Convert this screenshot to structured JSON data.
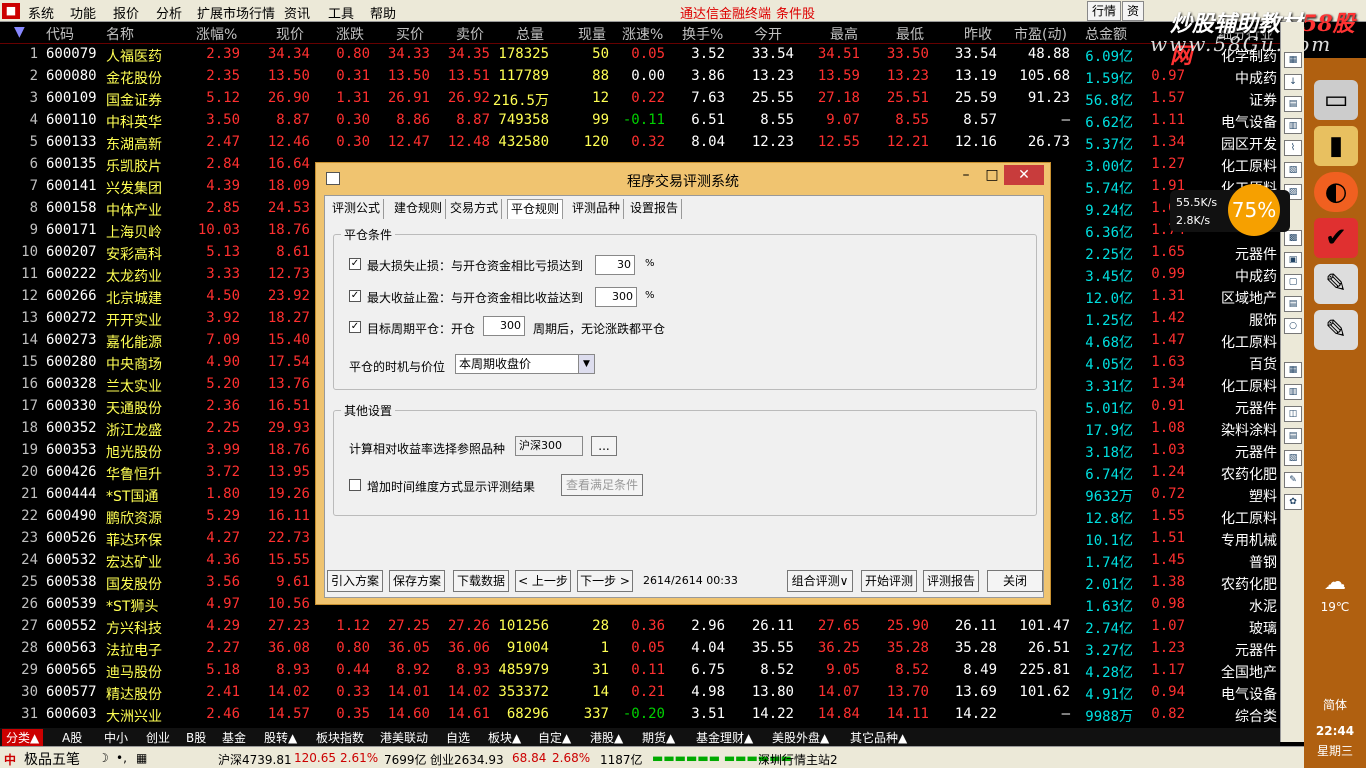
{
  "menu": {
    "items": [
      "系统",
      "功能",
      "报价",
      "分析",
      "扩展市场行情",
      "资讯",
      "工具",
      "帮助"
    ],
    "red": [
      "通达信金融终端",
      "条件股"
    ],
    "right": [
      "行情",
      "资"
    ]
  },
  "watermark": {
    "line1a": "炒股辅助教材",
    "line1b": "58股网",
    "line2": "www.58Gu.com"
  },
  "headers": [
    "代码",
    "名称",
    "涨幅%",
    "现价",
    "涨跌",
    "买价",
    "卖价",
    "总量",
    "现量",
    "涨速%",
    "换手%",
    "今开",
    "最高",
    "最低",
    "昨收",
    "市盈(动)",
    "总金额",
    "",
    "细分行业"
  ],
  "rows": [
    {
      "i": "1",
      "code": "600079",
      "name": "人福医药",
      "chg": "2.39",
      "price": "34.34",
      "diff": "0.80",
      "buy": "34.33",
      "sell": "34.35",
      "vol": "178325",
      "now": "50",
      "spd": "0.05",
      "turn": "3.52",
      "open": "33.54",
      "high": "34.51",
      "low": "33.50",
      "prev": "33.54",
      "pe": "48.88",
      "amt": "6.09亿",
      "x": "",
      "ind": "化学制药"
    },
    {
      "i": "2",
      "code": "600080",
      "name": "金花股份",
      "chg": "2.35",
      "price": "13.50",
      "diff": "0.31",
      "buy": "13.50",
      "sell": "13.51",
      "vol": "117789",
      "now": "88",
      "spd": "0.00",
      "turn": "3.86",
      "open": "13.23",
      "high": "13.59",
      "low": "13.23",
      "prev": "13.19",
      "pe": "105.68",
      "amt": "1.59亿",
      "x": "0.97",
      "ind": "中成药"
    },
    {
      "i": "3",
      "code": "600109",
      "name": "国金证券",
      "chg": "5.12",
      "price": "26.90",
      "diff": "1.31",
      "buy": "26.91",
      "sell": "26.92",
      "vol": "216.5万",
      "now": "12",
      "spd": "0.22",
      "turn": "7.63",
      "open": "25.55",
      "high": "27.18",
      "low": "25.51",
      "prev": "25.59",
      "pe": "91.23",
      "amt": "56.8亿",
      "x": "1.57",
      "ind": "证券"
    },
    {
      "i": "4",
      "code": "600110",
      "name": "中科英华",
      "chg": "3.50",
      "price": "8.87",
      "diff": "0.30",
      "buy": "8.86",
      "sell": "8.87",
      "vol": "749358",
      "now": "99",
      "spd": "-0.11",
      "turn": "6.51",
      "open": "8.55",
      "high": "9.07",
      "low": "8.55",
      "prev": "8.57",
      "pe": "—",
      "amt": "6.62亿",
      "x": "1.11",
      "ind": "电气设备"
    },
    {
      "i": "5",
      "code": "600133",
      "name": "东湖高新",
      "chg": "2.47",
      "price": "12.46",
      "diff": "0.30",
      "buy": "12.47",
      "sell": "12.48",
      "vol": "432580",
      "now": "120",
      "spd": "0.32",
      "turn": "8.04",
      "open": "12.23",
      "high": "12.55",
      "low": "12.21",
      "prev": "12.16",
      "pe": "26.73",
      "amt": "5.37亿",
      "x": "1.34",
      "ind": "园区开发"
    },
    {
      "i": "6",
      "code": "600135",
      "name": "乐凯胶片",
      "chg": "2.84",
      "price": "16.64",
      "diff": "",
      "buy": "",
      "sell": "",
      "vol": "",
      "now": "",
      "spd": "",
      "turn": "",
      "open": "",
      "high": "",
      "low": "",
      "prev": "",
      "pe": "",
      "amt": "3.00亿",
      "x": "1.27",
      "ind": "化工原料"
    },
    {
      "i": "7",
      "code": "600141",
      "name": "兴发集团",
      "chg": "4.39",
      "price": "18.09",
      "diff": "",
      "buy": "",
      "sell": "",
      "vol": "",
      "now": "",
      "spd": "",
      "turn": "",
      "open": "",
      "high": "",
      "low": "",
      "prev": "",
      "pe": "",
      "amt": "5.74亿",
      "x": "1.91",
      "ind": "化工原料"
    },
    {
      "i": "8",
      "code": "600158",
      "name": "中体产业",
      "chg": "2.85",
      "price": "24.53",
      "diff": "",
      "buy": "",
      "sell": "",
      "vol": "",
      "now": "",
      "spd": "",
      "turn": "",
      "open": "",
      "high": "",
      "low": "",
      "prev": "",
      "pe": "",
      "amt": "9.24亿",
      "x": "1.07",
      "ind": ""
    },
    {
      "i": "9",
      "code": "600171",
      "name": "上海贝岭",
      "chg": "10.03",
      "price": "18.76",
      "diff": "",
      "buy": "",
      "sell": "",
      "vol": "",
      "now": "",
      "spd": "",
      "turn": "",
      "open": "",
      "high": "",
      "low": "",
      "prev": "",
      "pe": "",
      "amt": "6.36亿",
      "x": "1.74",
      "ind": ""
    },
    {
      "i": "10",
      "code": "600207",
      "name": "安彩高科",
      "chg": "5.13",
      "price": "8.61",
      "diff": "",
      "buy": "",
      "sell": "",
      "vol": "",
      "now": "",
      "spd": "",
      "turn": "",
      "open": "",
      "high": "",
      "low": "",
      "prev": "",
      "pe": "",
      "amt": "2.25亿",
      "x": "1.65",
      "ind": "元器件"
    },
    {
      "i": "11",
      "code": "600222",
      "name": "太龙药业",
      "chg": "3.33",
      "price": "12.73",
      "diff": "",
      "buy": "",
      "sell": "",
      "vol": "",
      "now": "",
      "spd": "",
      "turn": "",
      "open": "",
      "high": "",
      "low": "",
      "prev": "",
      "pe": "",
      "amt": "3.45亿",
      "x": "0.99",
      "ind": "中成药"
    },
    {
      "i": "12",
      "code": "600266",
      "name": "北京城建",
      "chg": "4.50",
      "price": "23.92",
      "diff": "",
      "buy": "",
      "sell": "",
      "vol": "",
      "now": "",
      "spd": "",
      "turn": "",
      "open": "",
      "high": "",
      "low": "",
      "prev": "",
      "pe": "",
      "amt": "12.0亿",
      "x": "1.31",
      "ind": "区域地产"
    },
    {
      "i": "13",
      "code": "600272",
      "name": "开开实业",
      "chg": "3.92",
      "price": "18.27",
      "diff": "",
      "buy": "",
      "sell": "",
      "vol": "",
      "now": "",
      "spd": "",
      "turn": "",
      "open": "",
      "high": "",
      "low": "",
      "prev": "",
      "pe": "",
      "amt": "1.25亿",
      "x": "1.42",
      "ind": "服饰"
    },
    {
      "i": "14",
      "code": "600273",
      "name": "嘉化能源",
      "chg": "7.09",
      "price": "15.40",
      "diff": "",
      "buy": "",
      "sell": "",
      "vol": "",
      "now": "",
      "spd": "",
      "turn": "",
      "open": "",
      "high": "",
      "low": "",
      "prev": "",
      "pe": "",
      "amt": "4.68亿",
      "x": "1.47",
      "ind": "化工原料"
    },
    {
      "i": "15",
      "code": "600280",
      "name": "中央商场",
      "chg": "4.90",
      "price": "17.54",
      "diff": "",
      "buy": "",
      "sell": "",
      "vol": "",
      "now": "",
      "spd": "",
      "turn": "",
      "open": "",
      "high": "",
      "low": "",
      "prev": "",
      "pe": "",
      "amt": "4.05亿",
      "x": "1.63",
      "ind": "百货"
    },
    {
      "i": "16",
      "code": "600328",
      "name": "兰太实业",
      "chg": "5.20",
      "price": "13.76",
      "diff": "",
      "buy": "",
      "sell": "",
      "vol": "",
      "now": "",
      "spd": "",
      "turn": "",
      "open": "",
      "high": "",
      "low": "",
      "prev": "",
      "pe": "",
      "amt": "3.31亿",
      "x": "1.34",
      "ind": "化工原料"
    },
    {
      "i": "17",
      "code": "600330",
      "name": "天通股份",
      "chg": "2.36",
      "price": "16.51",
      "diff": "",
      "buy": "",
      "sell": "",
      "vol": "",
      "now": "",
      "spd": "",
      "turn": "",
      "open": "",
      "high": "",
      "low": "",
      "prev": "",
      "pe": "",
      "amt": "5.01亿",
      "x": "0.91",
      "ind": "元器件"
    },
    {
      "i": "18",
      "code": "600352",
      "name": "浙江龙盛",
      "chg": "2.25",
      "price": "29.93",
      "diff": "",
      "buy": "",
      "sell": "",
      "vol": "",
      "now": "",
      "spd": "",
      "turn": "",
      "open": "",
      "high": "",
      "low": "",
      "prev": "",
      "pe": "",
      "amt": "17.9亿",
      "x": "1.08",
      "ind": "染料涂料"
    },
    {
      "i": "19",
      "code": "600353",
      "name": "旭光股份",
      "chg": "3.99",
      "price": "18.76",
      "diff": "",
      "buy": "",
      "sell": "",
      "vol": "",
      "now": "",
      "spd": "",
      "turn": "",
      "open": "",
      "high": "",
      "low": "",
      "prev": "",
      "pe": "",
      "amt": "3.18亿",
      "x": "1.03",
      "ind": "元器件"
    },
    {
      "i": "20",
      "code": "600426",
      "name": "华鲁恒升",
      "chg": "3.72",
      "price": "13.95",
      "diff": "",
      "buy": "",
      "sell": "",
      "vol": "",
      "now": "",
      "spd": "",
      "turn": "",
      "open": "",
      "high": "",
      "low": "",
      "prev": "",
      "pe": "",
      "amt": "6.74亿",
      "x": "1.24",
      "ind": "农药化肥"
    },
    {
      "i": "21",
      "code": "600444",
      "name": "*ST国通",
      "chg": "1.80",
      "price": "19.26",
      "diff": "",
      "buy": "",
      "sell": "",
      "vol": "",
      "now": "",
      "spd": "",
      "turn": "",
      "open": "",
      "high": "",
      "low": "",
      "prev": "",
      "pe": "",
      "amt": "9632万",
      "x": "0.72",
      "ind": "塑料"
    },
    {
      "i": "22",
      "code": "600490",
      "name": "鹏欣资源",
      "chg": "5.29",
      "price": "16.11",
      "diff": "",
      "buy": "",
      "sell": "",
      "vol": "",
      "now": "",
      "spd": "",
      "turn": "",
      "open": "",
      "high": "",
      "low": "",
      "prev": "",
      "pe": "",
      "amt": "12.8亿",
      "x": "1.55",
      "ind": "化工原料"
    },
    {
      "i": "23",
      "code": "600526",
      "name": "菲达环保",
      "chg": "4.27",
      "price": "22.73",
      "diff": "",
      "buy": "",
      "sell": "",
      "vol": "",
      "now": "",
      "spd": "",
      "turn": "",
      "open": "",
      "high": "",
      "low": "",
      "prev": "",
      "pe": "",
      "amt": "10.1亿",
      "x": "1.51",
      "ind": "专用机械"
    },
    {
      "i": "24",
      "code": "600532",
      "name": "宏达矿业",
      "chg": "4.36",
      "price": "15.55",
      "diff": "",
      "buy": "",
      "sell": "",
      "vol": "",
      "now": "",
      "spd": "",
      "turn": "",
      "open": "",
      "high": "",
      "low": "",
      "prev": "",
      "pe": "",
      "amt": "1.74亿",
      "x": "1.45",
      "ind": "普钢"
    },
    {
      "i": "25",
      "code": "600538",
      "name": "国发股份",
      "chg": "3.56",
      "price": "9.61",
      "diff": "",
      "buy": "",
      "sell": "",
      "vol": "",
      "now": "",
      "spd": "",
      "turn": "",
      "open": "",
      "high": "",
      "low": "",
      "prev": "",
      "pe": "",
      "amt": "2.01亿",
      "x": "1.38",
      "ind": "农药化肥"
    },
    {
      "i": "26",
      "code": "600539",
      "name": "*ST狮头",
      "chg": "4.97",
      "price": "10.56",
      "diff": "",
      "buy": "",
      "sell": "",
      "vol": "",
      "now": "",
      "spd": "",
      "turn": "",
      "open": "",
      "high": "",
      "low": "",
      "prev": "",
      "pe": "",
      "amt": "1.63亿",
      "x": "0.98",
      "ind": "水泥"
    },
    {
      "i": "27",
      "code": "600552",
      "name": "方兴科技",
      "chg": "4.29",
      "price": "27.23",
      "diff": "1.12",
      "buy": "27.25",
      "sell": "27.26",
      "vol": "101256",
      "now": "28",
      "spd": "0.36",
      "turn": "2.96",
      "open": "26.11",
      "high": "27.65",
      "low": "25.90",
      "prev": "26.11",
      "pe": "101.47",
      "amt": "2.74亿",
      "x": "1.07",
      "ind": "玻璃"
    },
    {
      "i": "28",
      "code": "600563",
      "name": "法拉电子",
      "chg": "2.27",
      "price": "36.08",
      "diff": "0.80",
      "buy": "36.05",
      "sell": "36.06",
      "vol": "91004",
      "now": "1",
      "spd": "0.05",
      "turn": "4.04",
      "open": "35.55",
      "high": "36.25",
      "low": "35.28",
      "prev": "35.28",
      "pe": "26.51",
      "amt": "3.27亿",
      "x": "1.23",
      "ind": "元器件"
    },
    {
      "i": "29",
      "code": "600565",
      "name": "迪马股份",
      "chg": "5.18",
      "price": "8.93",
      "diff": "0.44",
      "buy": "8.92",
      "sell": "8.93",
      "vol": "485979",
      "now": "31",
      "spd": "0.11",
      "turn": "6.75",
      "open": "8.52",
      "high": "9.05",
      "low": "8.52",
      "prev": "8.49",
      "pe": "225.81",
      "amt": "4.28亿",
      "x": "1.17",
      "ind": "全国地产"
    },
    {
      "i": "30",
      "code": "600577",
      "name": "精达股份",
      "chg": "2.41",
      "price": "14.02",
      "diff": "0.33",
      "buy": "14.01",
      "sell": "14.02",
      "vol": "353372",
      "now": "14",
      "spd": "0.21",
      "turn": "4.98",
      "open": "13.80",
      "high": "14.07",
      "low": "13.70",
      "prev": "13.69",
      "pe": "101.62",
      "amt": "4.91亿",
      "x": "0.94",
      "ind": "电气设备"
    },
    {
      "i": "31",
      "code": "600603",
      "name": "大洲兴业",
      "chg": "2.46",
      "price": "14.57",
      "diff": "0.35",
      "buy": "14.60",
      "sell": "14.61",
      "vol": "68296",
      "now": "337",
      "spd": "-0.20",
      "turn": "3.51",
      "open": "14.22",
      "high": "14.84",
      "low": "14.11",
      "prev": "14.22",
      "pe": "—",
      "amt": "9988万",
      "x": "0.82",
      "ind": "综合类"
    }
  ],
  "tabs": [
    "分类▲",
    "A股",
    "中小",
    "创业",
    "B股",
    "基金",
    "股转▲",
    "板块指数",
    "港美联动",
    "自选",
    "板块▲",
    "自定▲",
    "港股▲",
    "期货▲",
    "基金理财▲",
    "美股外盘▲",
    "其它品种▲"
  ],
  "status": {
    "ime": "极品五笔",
    "sh": "沪深4739.81",
    "sh_chg": "120.65",
    "sh_pct": "2.61%",
    "sh_vol": "7699亿",
    "cy": "创业2634.93",
    "cy_chg": "68.84",
    "cy_pct": "2.68%",
    "cy_vol": "1187亿",
    "server": "深圳行情主站2"
  },
  "net": {
    "up": "55.5K/s",
    "down": "2.8K/s",
    "pct": "75%"
  },
  "clock": {
    "temp": "19℃",
    "lang": "简体",
    "time": "22:44",
    "day": "星期三"
  },
  "dialog": {
    "title": "程序交易评测系统",
    "tabs": [
      "评测公式",
      "建仓规则",
      "交易方式",
      "平仓规则",
      "评测品种",
      "设置报告"
    ],
    "g1": "平仓条件",
    "c1": "最大损失止损：与开仓资金相比亏损达到",
    "v1": "30",
    "u1": "%",
    "c2": "最大收益止盈：与开仓资金相比收益达到",
    "v2": "300",
    "u2": "%",
    "c3a": "目标周期平仓：开仓",
    "v3": "300",
    "c3b": "周期后，无论涨跌都平仓",
    "timing_label": "平仓的时机与价位",
    "timing_value": "本周期收盘价",
    "g2": "其他设置",
    "ref_label": "计算相对收益率选择参照品种",
    "ref_value": "沪深300",
    "ref_btn": "...",
    "c4": "增加时间维度方式显示评测结果",
    "view_btn": "查看满足条件",
    "buttons": [
      "引入方案",
      "保存方案",
      "下载数据",
      "< 上一步",
      "下一步 >"
    ],
    "progress": "2614/2614 00:33",
    "buttons2": [
      "组合评测∨",
      "开始评测",
      "评测报告",
      "关闭"
    ]
  }
}
